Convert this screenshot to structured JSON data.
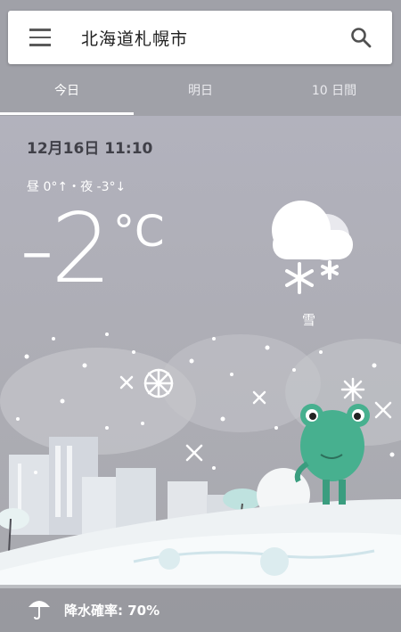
{
  "search": {
    "location": "北海道札幌市"
  },
  "tabs": [
    {
      "label": "今日",
      "active": true
    },
    {
      "label": "明日",
      "active": false
    },
    {
      "label": "10 日間",
      "active": false
    }
  ],
  "current": {
    "datetime": "12月16日 11:10",
    "hilo": "昼 0°↑・夜 -3°↓",
    "temperature": "-2",
    "unit": "°C",
    "condition": "雪"
  },
  "precipitation": {
    "label": "降水確率: 70%"
  },
  "icons": {
    "menu": "menu-icon",
    "search": "search-icon",
    "weather": "snow-cloud-icon",
    "umbrella": "umbrella-icon"
  },
  "colors": {
    "sky": "#b2b2bd",
    "accent": "#ffffff",
    "frog": "#47b08f"
  }
}
